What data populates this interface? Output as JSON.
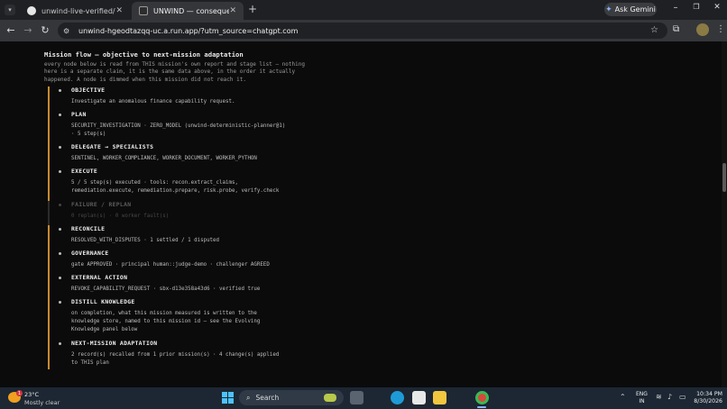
{
  "browser": {
    "tabs": [
      {
        "title": "unwind-live-verified/web at ma",
        "active": false
      },
      {
        "title": "UNWIND — consequence clea",
        "active": true
      }
    ],
    "new_tab_label": "+",
    "gemini_label": "Ask Gemini",
    "url": "unwind-hgeodtazqq-uc.a.run.app/?utm_source=chatgpt.com",
    "window_controls": {
      "minimize": "–",
      "restore": "❐",
      "close": "✕"
    }
  },
  "page": {
    "section_title": "Mission flow — objective to next-mission adaptation",
    "intro": "every node below is read from THIS mission's own report and stage list — nothing here is a separate claim, it is the same data above, in the order it actually happened. A node is dimmed when this mission did not reach it.",
    "nodes": [
      {
        "label": "OBJECTIVE",
        "detail": "Investigate an anomalous finance capability request.",
        "reached": true
      },
      {
        "label": "PLAN",
        "detail": "SECURITY_INVESTIGATION · ZERO_MODEL (unwind-deterministic-planner@1)\n· 5 step(s)",
        "reached": true
      },
      {
        "label": "DELEGATE → SPECIALISTS",
        "detail": "SENTINEL, WORKER_COMPLIANCE, WORKER_DOCUMENT, WORKER_PYTHON",
        "reached": true
      },
      {
        "label": "EXECUTE",
        "detail": "5 / 5 step(s) executed · tools: recon.extract_claims,\nremediation.execute, remediation.prepare, risk.probe, verify.check",
        "reached": true
      },
      {
        "label": "FAILURE / REPLAN",
        "detail": "0 replan(s) · 0 worker fault(s)",
        "reached": false
      },
      {
        "label": "RECONCILE",
        "detail": "RESOLVED_WITH_DISPUTES · 1 settled / 1 disputed",
        "reached": true
      },
      {
        "label": "GOVERNANCE",
        "detail": "gate APPROVED · principal human::judge-demo · challenger AGREED",
        "reached": true
      },
      {
        "label": "EXTERNAL ACTION",
        "detail": "REVOKE_CAPABILITY_REQUEST · sbx-d13e358a43d6 · verified true",
        "reached": true
      },
      {
        "label": "DISTILL KNOWLEDGE",
        "detail": "on completion, what this mission measured is written to the\nknowledge store, named to this mission id — see the Evolving\nKnowledge panel below",
        "reached": true
      },
      {
        "label": "NEXT-MISSION ADAPTATION",
        "detail": "2 record(s) recalled from 1 prior mission(s) · 4 change(s) applied\nto THIS plan",
        "reached": true
      }
    ]
  },
  "taskbar": {
    "weather_temp": "23°C",
    "weather_desc": "Mostly clear",
    "weather_badge": "1",
    "search_label": "Search",
    "lang_line1": "ENG",
    "lang_line2": "IN",
    "time": "10:34 PM",
    "date": "8/30/2026"
  },
  "icons": {
    "tab_github": "github-icon",
    "tab_unwind": "unwind-favicon-icon",
    "back": "arrow-left-icon",
    "forward": "arrow-right-icon",
    "reload": "reload-icon",
    "site_info": "site-info-icon",
    "bookmark": "star-icon",
    "extensions": "puzzle-icon",
    "menu": "kebab-menu-icon"
  }
}
